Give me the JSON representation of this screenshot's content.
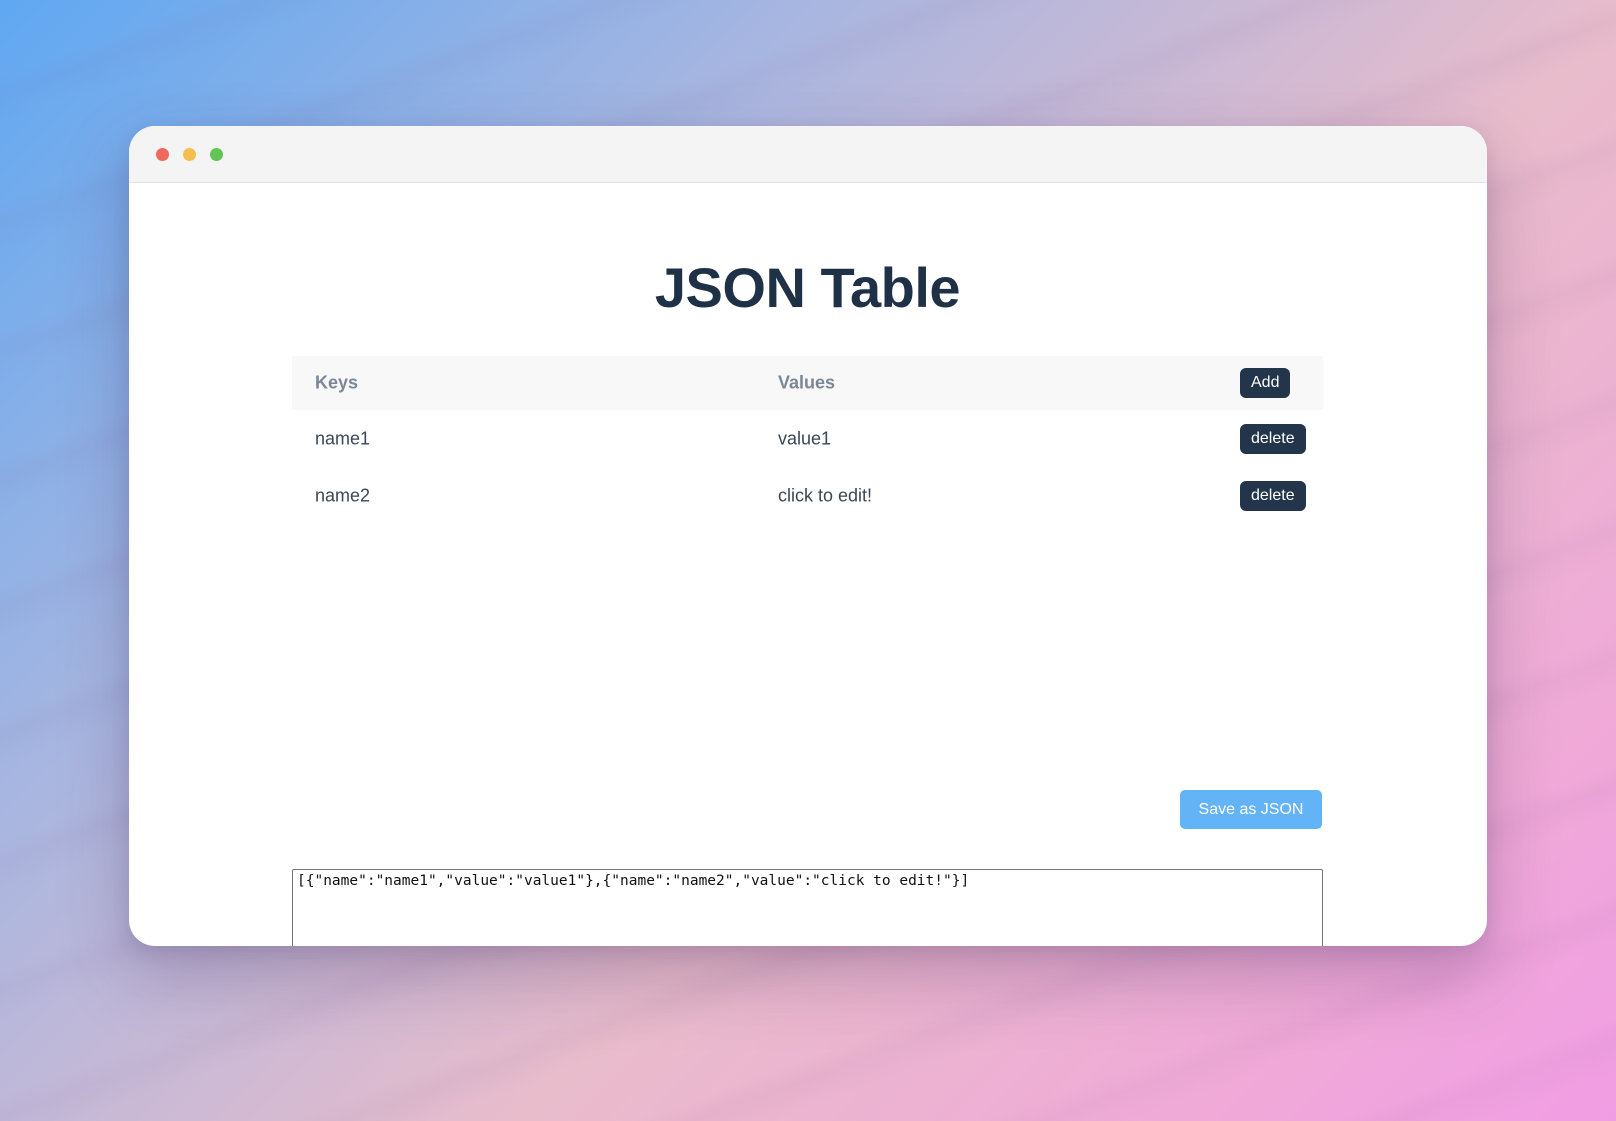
{
  "window": {
    "controls": [
      "close",
      "minimize",
      "maximize"
    ]
  },
  "page": {
    "title": "JSON Table"
  },
  "table": {
    "headers": {
      "keys": "Keys",
      "values": "Values",
      "add_label": "Add"
    },
    "rows": [
      {
        "key": "name1",
        "value": "value1",
        "delete_label": "delete"
      },
      {
        "key": "name2",
        "value": "click to edit!",
        "delete_label": "delete"
      }
    ]
  },
  "save_button_label": "Save as JSON",
  "json_output": "[{\"name\":\"name1\",\"value\":\"value1\"},{\"name\":\"name2\",\"value\":\"click to edit!\"}]",
  "colors": {
    "title": "#1f3147",
    "dark_button": "#22354a",
    "save_button": "#63b3f7",
    "close_dot": "#ee6a5f",
    "minimize_dot": "#f5bf4f",
    "maximize_dot": "#61c454"
  }
}
